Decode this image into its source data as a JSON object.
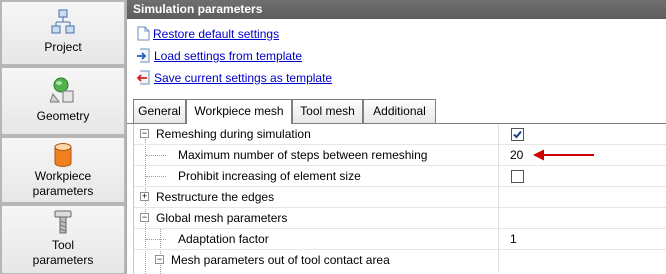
{
  "nav": [
    {
      "label_lines": [
        "Project"
      ],
      "icon": "project-tree-icon",
      "active": false
    },
    {
      "label_lines": [
        "Geometry"
      ],
      "icon": "geometry-shapes-icon",
      "active": false
    },
    {
      "label_lines": [
        "Workpiece",
        "parameters"
      ],
      "icon": "workpiece-cylinder-icon",
      "active": false
    },
    {
      "label_lines": [
        "Tool",
        "parameters"
      ],
      "icon": "tool-icon",
      "active": false
    }
  ],
  "panel": {
    "title": "Simulation parameters",
    "links": [
      {
        "label": "Restore default settings",
        "icon": "document-icon"
      },
      {
        "label": "Load settings from template",
        "icon": "load-arrow-icon"
      },
      {
        "label": "Save current settings as template",
        "icon": "save-arrow-icon"
      }
    ],
    "tabs": [
      {
        "label": "General",
        "active": false
      },
      {
        "label": "Workpiece mesh",
        "active": true
      },
      {
        "label": "Tool mesh",
        "active": false
      },
      {
        "label": "Additional",
        "active": false
      }
    ]
  },
  "grid": {
    "rows": [
      {
        "label": "Remeshing during simulation",
        "expander": "minus",
        "value_type": "checkbox",
        "checked": true
      },
      {
        "label": "Maximum number of steps between remeshing",
        "value_type": "text",
        "value": "20"
      },
      {
        "label": "Prohibit increasing of element size",
        "value_type": "checkbox",
        "checked": false
      },
      {
        "label": "Restructure the edges",
        "expander": "plus",
        "value_type": "none"
      },
      {
        "label": "Global mesh parameters",
        "expander": "minus",
        "value_type": "none"
      },
      {
        "label": "Adaptation factor",
        "value_type": "text",
        "value": "1"
      },
      {
        "label": "Mesh parameters out of tool contact area",
        "expander": "minus",
        "value_type": "none"
      }
    ]
  },
  "colors": {
    "titlebar": "#666666",
    "link": "#0000cc",
    "annotation_arrow": "#cc0000"
  }
}
